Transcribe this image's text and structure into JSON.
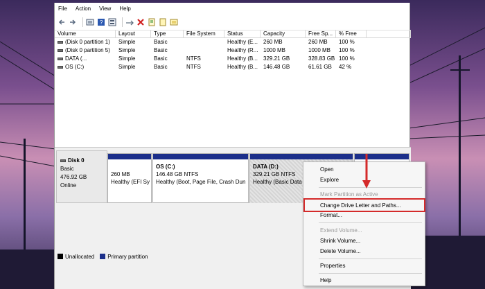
{
  "menu": [
    "File",
    "Action",
    "View",
    "Help"
  ],
  "toolbar_icons": [
    "back-icon",
    "forward-icon",
    "disk-list-icon",
    "help-icon",
    "volume-list-icon",
    "connect-icon",
    "delete-icon",
    "properties-icon",
    "new-icon",
    "view-icon"
  ],
  "volume_table": {
    "columns": [
      "Volume",
      "Layout",
      "Type",
      "File System",
      "Status",
      "Capacity",
      "Free Sp...",
      "% Free"
    ],
    "rows": [
      [
        "(Disk 0 partition 1)",
        "Simple",
        "Basic",
        "",
        "Healthy (E...",
        "260 MB",
        "260 MB",
        "100 %"
      ],
      [
        "(Disk 0 partition 5)",
        "Simple",
        "Basic",
        "",
        "Healthy (R...",
        "1000 MB",
        "1000 MB",
        "100 %"
      ],
      [
        "DATA (...",
        "Simple",
        "Basic",
        "NTFS",
        "Healthy (B...",
        "329.21 GB",
        "328.83 GB",
        "100 %"
      ],
      [
        "OS (C:)",
        "Simple",
        "Basic",
        "NTFS",
        "Healthy (B...",
        "146.48 GB",
        "61.61 GB",
        "42 %"
      ]
    ]
  },
  "disk": {
    "name": "Disk 0",
    "type": "Basic",
    "size": "476.92 GB",
    "state": "Online"
  },
  "partitions": [
    {
      "name": "",
      "size": "260 MB",
      "status": "Healthy (EFI Sy"
    },
    {
      "name": "OS (C:)",
      "size": "146.48 GB NTFS",
      "status": "Healthy (Boot, Page File, Crash Dun"
    },
    {
      "name": "DATA (D:)",
      "size": "329.21 GB NTFS",
      "status": "Healthy (Basic Data"
    }
  ],
  "legend": [
    {
      "label": "Unallocated",
      "color": "#000000"
    },
    {
      "label": "Primary partition",
      "color": "#1c2f8a"
    }
  ],
  "context_menu": [
    {
      "label": "Open",
      "enabled": true
    },
    {
      "label": "Explore",
      "enabled": true
    },
    {
      "label": "Mark Partition as Active",
      "enabled": false
    },
    {
      "label": "Change Drive Letter and Paths...",
      "enabled": true
    },
    {
      "label": "Format...",
      "enabled": true
    },
    {
      "label": "Extend Volume...",
      "enabled": false
    },
    {
      "label": "Shrink Volume...",
      "enabled": true
    },
    {
      "label": "Delete Volume...",
      "enabled": true
    },
    {
      "label": "Properties",
      "enabled": true
    },
    {
      "label": "Help",
      "enabled": true
    }
  ],
  "colors": {
    "partition_bar": "#1c2f8a",
    "highlight": "#d42a2a"
  }
}
